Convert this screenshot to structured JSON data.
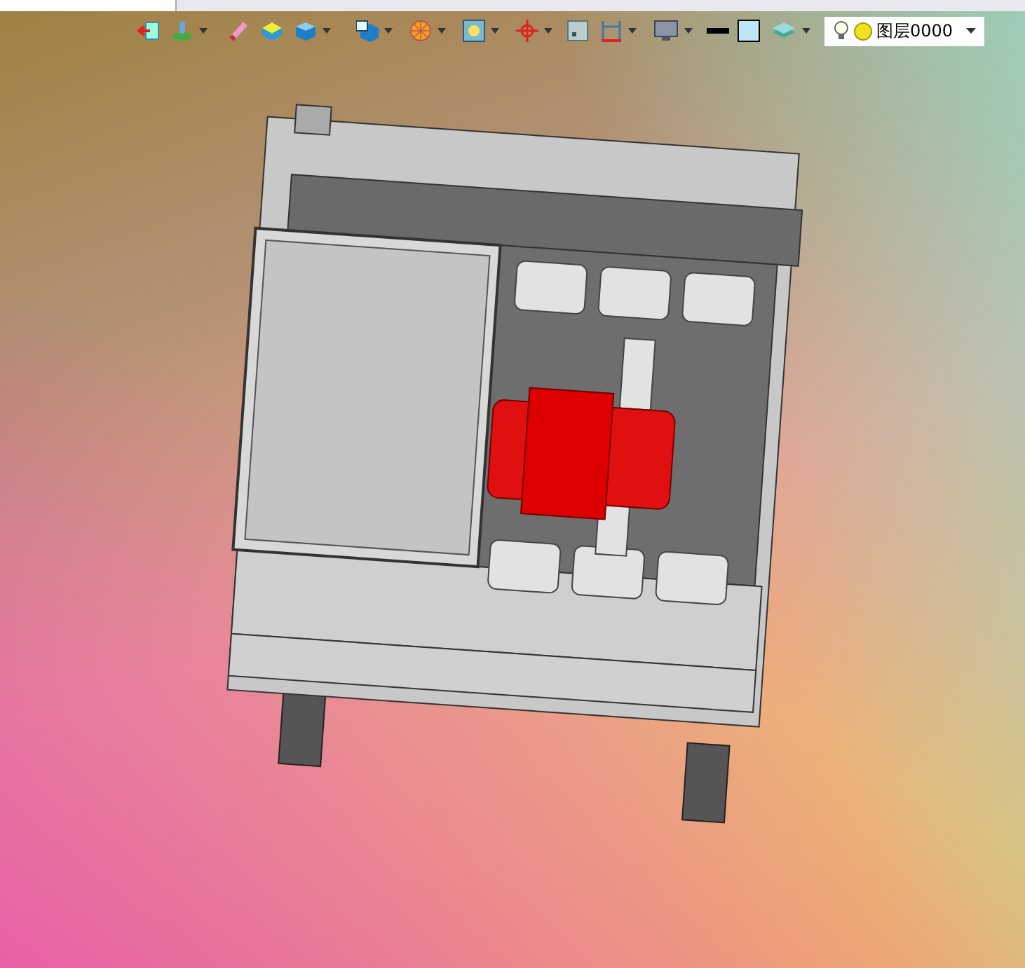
{
  "toolbar": {
    "buttons": [
      {
        "kind": "exit",
        "dropdown": false
      },
      {
        "kind": "figure",
        "dropdown": true
      },
      {
        "kind": "brush",
        "dropdown": false
      },
      {
        "kind": "block",
        "dropdown": false
      },
      {
        "kind": "cube",
        "dropdown": true
      },
      {
        "kind": "cube-view",
        "dropdown": true
      },
      {
        "kind": "ball",
        "dropdown": true
      },
      {
        "kind": "frame",
        "dropdown": true
      },
      {
        "kind": "target",
        "dropdown": true
      },
      {
        "kind": "square",
        "dropdown": false
      },
      {
        "kind": "dimension",
        "dropdown": true
      },
      {
        "kind": "monitor",
        "dropdown": true
      },
      {
        "kind": "line",
        "dropdown": false
      },
      {
        "kind": "fill",
        "dropdown": false
      },
      {
        "kind": "layers",
        "dropdown": true
      }
    ]
  },
  "layer_selector": {
    "value": "图层0000"
  }
}
